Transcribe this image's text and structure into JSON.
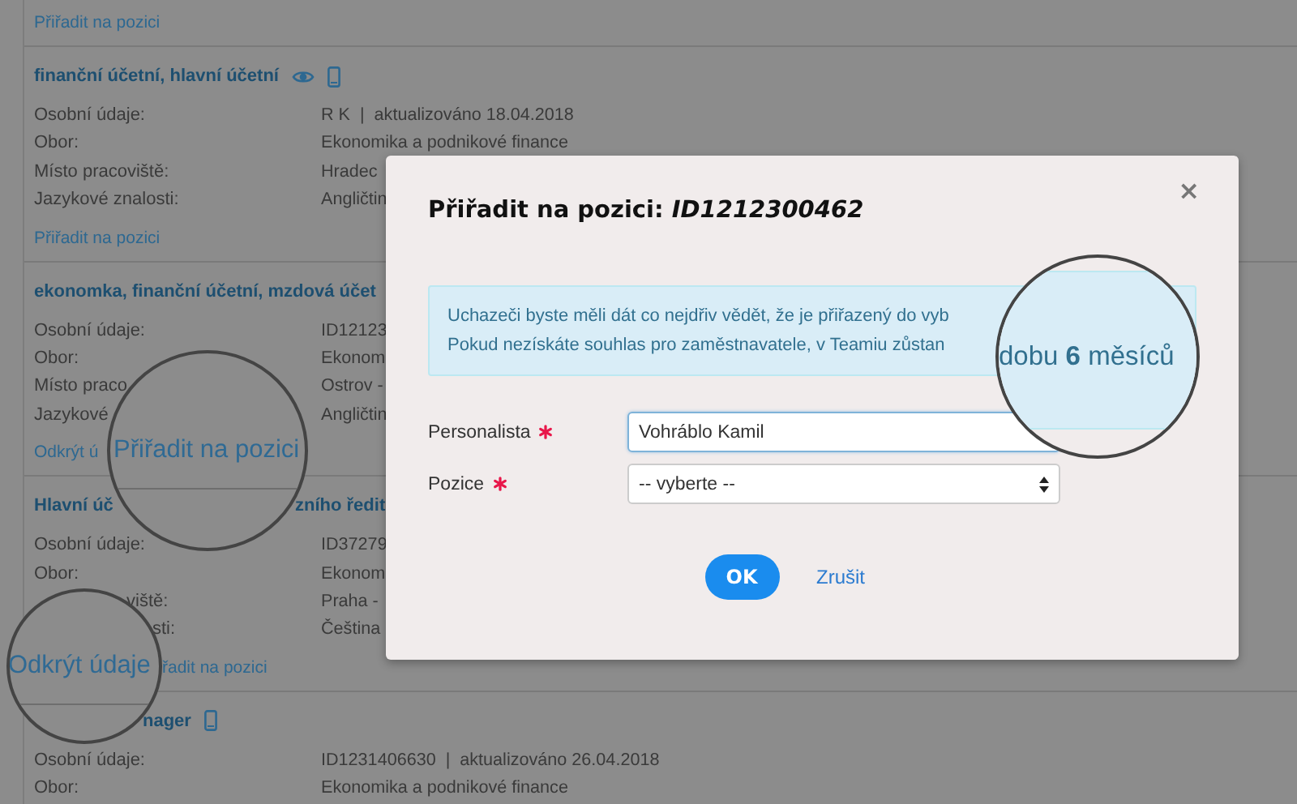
{
  "candidates": [
    {
      "links": [
        [
          "Přiřadit na pozici"
        ]
      ]
    },
    {
      "title": [
        "finanční účetní, hlavní účetní"
      ],
      "seen": true,
      "phone": true,
      "rows": [
        {
          "label": [
            "Osobní údaje:"
          ],
          "value": "R K  |  aktualizováno 18.04.2018"
        },
        {
          "label": [
            "Obor:"
          ],
          "value": "Ekonomika a podnikové finance"
        },
        {
          "label": [
            "Místo pracoviště:"
          ],
          "value": "Hradec"
        },
        {
          "label": [
            "Jazykové znalosti:"
          ],
          "value": "Angličtin"
        }
      ],
      "links": [
        [
          "Přiřadit na pozici"
        ]
      ]
    },
    {
      "title": [
        "ekonomka, finanční účetní, mzdová účet"
      ],
      "seen": false,
      "phone": false,
      "rows": [
        {
          "label": [
            "Osobní údaje:"
          ],
          "value": "ID12123"
        },
        {
          "label": [
            "Obor:"
          ],
          "value": "Ekonom"
        },
        {
          "label": [
            "Místo praco"
          ],
          "value": "Ostrov -"
        },
        {
          "label": [
            "Jazykové"
          ],
          "value": "Angličtin"
        }
      ],
      "links": [
        [
          "Odkrýt ú"
        ]
      ]
    },
    {
      "title": [
        "Hlavní úč",
        "zního ředit"
      ],
      "seen": false,
      "phone": false,
      "rows": [
        {
          "label": [
            "Osobní údaje:"
          ],
          "value": "ID37279"
        },
        {
          "label": [
            "Obor:"
          ],
          "value": "Ekonom"
        },
        {
          "label": [
            "viště:"
          ],
          "value": "Praha -"
        },
        {
          "label": [
            "sti:"
          ],
          "value": "Čeština"
        }
      ],
      "links": [
        [
          "řadit na pozici"
        ]
      ]
    },
    {
      "title": [
        "nager"
      ],
      "seen": false,
      "phone": true,
      "rows": [
        {
          "label": [
            "Osobní údaje:"
          ],
          "value": "ID1231406630  |  aktualizováno 26.04.2018"
        },
        {
          "label": [
            "Obor:"
          ],
          "value": "Ekonomika a podnikové finance"
        }
      ]
    }
  ],
  "modal": {
    "title": "Přiřadit na pozici: *ID1212300462*",
    "close": "×",
    "notice": [
      "Uchazeči byste měli dát co nejdřiv vědět, že je přiřazený do vyb",
      "Pokud nezískáte souhlas pro zaměstnavatele, v Teamiu zůstan"
    ],
    "fields": [
      {
        "label": "Personalista",
        "required": true,
        "kind": "text",
        "value": "Vohráblo Kamil",
        "focused": true
      },
      {
        "label": "Pozice",
        "required": true,
        "kind": "select",
        "value": "-- vyberte --",
        "focused": false
      }
    ],
    "ok": "OK",
    "cancel": "Zrušit"
  },
  "lenses": [
    {
      "kind": "link",
      "text": "Přiřadit na pozici"
    },
    {
      "kind": "link",
      "text": "Odkrýt údaje"
    },
    {
      "kind": "info",
      "text": "dobu **6** měsíců"
    }
  ]
}
